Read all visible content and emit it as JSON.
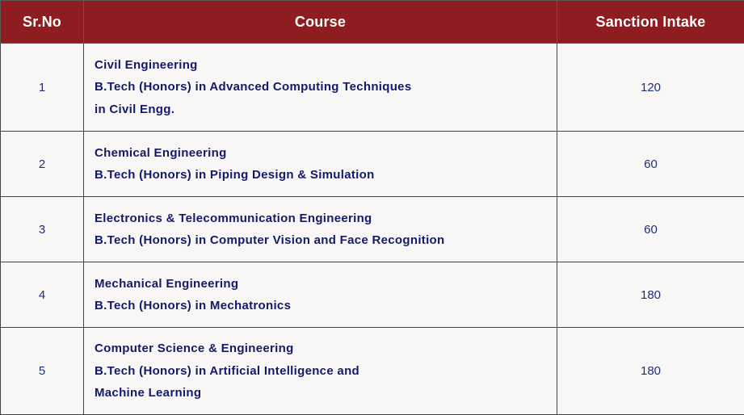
{
  "table": {
    "headers": {
      "sr_no": "Sr.No",
      "course": "Course",
      "intake": "Sanction Intake"
    },
    "rows": [
      {
        "sr_no": "1",
        "lines": [
          "Civil Engineering",
          "B.Tech (Honors) in Advanced Computing Techniques",
          "in Civil Engg."
        ],
        "intake": "120"
      },
      {
        "sr_no": "2",
        "lines": [
          "Chemical Engineering",
          "B.Tech (Honors) in Piping Design & Simulation"
        ],
        "intake": "60"
      },
      {
        "sr_no": "3",
        "lines": [
          "Electronics & Telecommunication Engineering",
          "B.Tech (Honors) in Computer Vision and Face Recognition"
        ],
        "intake": "60"
      },
      {
        "sr_no": "4",
        "lines": [
          "Mechanical Engineering",
          "B.Tech (Honors) in Mechatronics"
        ],
        "intake": "180"
      },
      {
        "sr_no": "5",
        "lines": [
          "Computer Science & Engineering",
          "B.Tech (Honors) in Artificial Intelligence and",
          "Machine Learning"
        ],
        "intake": "180"
      }
    ]
  },
  "colors": {
    "header_bg": "#8f1c1e",
    "header_text": "#ffffff",
    "cell_bg": "#f8f7f5",
    "body_text": "#1e2f7a"
  }
}
